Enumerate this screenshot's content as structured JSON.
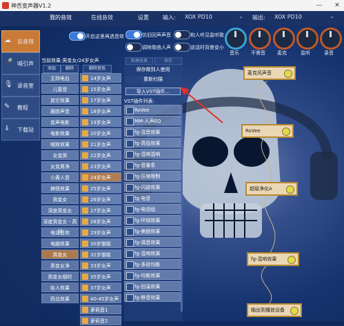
{
  "window": {
    "title": "神舌变声器V1.2"
  },
  "topbar": {
    "tabs": [
      "我的音效",
      "在线音效",
      "设置"
    ],
    "input_label": "输入:",
    "input_device": "XOX PD10",
    "output_label": "输出:",
    "output_device": "XOX PD10"
  },
  "leftnav": {
    "items": [
      {
        "label": "云音效",
        "icon": "cloud-icon"
      },
      {
        "label": "喊引声",
        "icon": "mic-icon"
      },
      {
        "label": "录音室",
        "icon": "mic-icon"
      },
      {
        "label": "教程",
        "icon": "book-icon"
      },
      {
        "label": "下载站",
        "icon": "download-icon"
      }
    ]
  },
  "toggles": [
    {
      "label": "开启这里再选音效",
      "on": true
    },
    {
      "label": "仿旧回声声音",
      "on": true
    },
    {
      "label": "和人听见监听歌",
      "on": false
    },
    {
      "label": "调除歌曲人声",
      "on": false
    },
    {
      "label": "说话时背景变小",
      "on": false
    }
  ],
  "knobs": [
    "音乐",
    "不需音",
    "麦克",
    "监听",
    "录音"
  ],
  "effects": {
    "current": "当前效果:男变女/24岁女声",
    "buttons": [
      "添加",
      "删除",
      "删除音效",
      "新建效果",
      "保存"
    ],
    "col_a": [
      "主持电台",
      "儿童音",
      "其它效果",
      "跟踪声音",
      "变声电影",
      "电影效果",
      "喊效效果",
      "女变男",
      "女变男净",
      "小黄人音",
      "搞怪效果",
      "男变女",
      "深度男变女",
      "深度男变女 - 高端",
      "电话音效",
      "电脑效果",
      "男变女",
      "男变女净",
      "男变女细时",
      "娃人效果",
      "西北效果"
    ],
    "col_a_selected": 16,
    "col_b": [
      "14岁女声",
      "15岁女声",
      "17岁女声",
      "18岁女声",
      "19岁女声",
      "20岁女声",
      "21岁女声",
      "22岁女声",
      "23岁女声",
      "24岁女声",
      "25岁女声",
      "26岁女声",
      "27岁女声",
      "28岁女声",
      "29岁女声",
      "30岁御姐",
      "32岁御姐",
      "33岁女声",
      "35岁女声",
      "37岁女声",
      "40-45岁女声",
      "萝莉音1",
      "萝莉音2"
    ],
    "col_b_selected": 9
  },
  "vst": {
    "header": "保存做到人使用",
    "refresh": "重新扫描",
    "import": "导入VST插件...",
    "list_title": "VST插件列表:",
    "items": [
      "RoVee",
      "MM-人声EQ",
      "fg-混音效果",
      "fg-高低效果",
      "fg-混响混响",
      "fg-音量条",
      "fg-压缩限制",
      "fg-闪避效果",
      "fg-电音",
      "fg-电话组",
      "fg-环绕效果",
      "fg-美颜效果",
      "fg-调音效果",
      "fg-混响效果",
      "fg-多段均衡",
      "fg-均衡效果",
      "fg-回溪效果",
      "fg-移音效果"
    ]
  },
  "chain": [
    "麦克风声音",
    "RoVee",
    "超级净化A",
    "fg-混响效果",
    "输出到播放设备"
  ]
}
